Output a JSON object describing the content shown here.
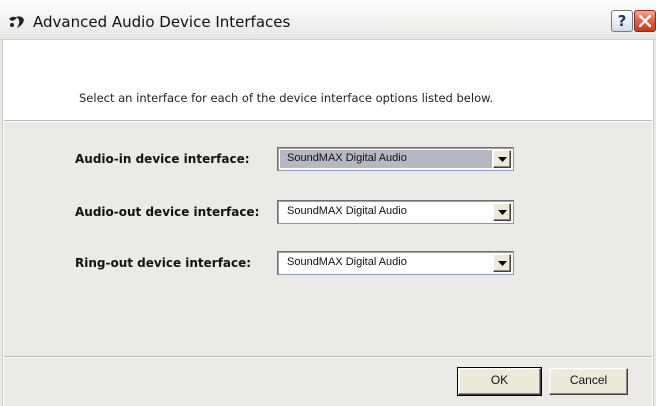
{
  "window": {
    "title": "Advanced Audio Device Interfaces",
    "help_label": "?",
    "icon": "audio-app-icon",
    "close_icon": "close-icon"
  },
  "instructions": "Select an interface for each of the device interface options listed below.",
  "rows": [
    {
      "label": "Audio-in device interface:",
      "value": "SoundMAX Digital Audio",
      "selected": true
    },
    {
      "label": "Audio-out device interface:",
      "value": "SoundMAX Digital Audio",
      "selected": false
    },
    {
      "label": "Ring-out device interface:",
      "value": "SoundMAX Digital Audio",
      "selected": false
    }
  ],
  "buttons": {
    "ok": "OK",
    "cancel": "Cancel"
  },
  "colors": {
    "close_red": "#d9482a",
    "selected_highlight": "#b5b8c2",
    "body_background": "#ebeae6"
  }
}
